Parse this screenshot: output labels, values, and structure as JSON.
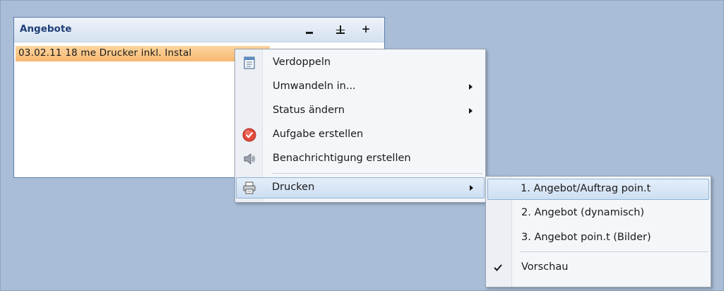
{
  "panel": {
    "title": "Angebote",
    "buttons": {
      "minimize": "minimize",
      "pin": "pin",
      "add": "+"
    },
    "record": "03.02.11  18  me  Drucker inkl. Instal"
  },
  "context_menu": {
    "items": [
      {
        "label": "Verdoppeln",
        "icon": "duplicate-icon"
      },
      {
        "label": "Umwandeln in...",
        "submenu": true
      },
      {
        "label": "Status ändern",
        "submenu": true
      },
      {
        "label": "Aufgabe erstellen",
        "icon": "task-check-icon"
      },
      {
        "label": "Benachrichtigung erstellen",
        "icon": "speaker-icon"
      },
      {
        "label": "Drucken",
        "icon": "printer-icon",
        "submenu": true,
        "highlighted": true
      }
    ]
  },
  "print_submenu": {
    "items": [
      {
        "label": "1. Angebot/Auftrag poin.t",
        "highlighted": true
      },
      {
        "label": "2. Angebot (dynamisch)"
      },
      {
        "label": "3. Angebot poin.t (Bilder)"
      },
      {
        "label": "Vorschau",
        "checked": true
      }
    ]
  },
  "colors": {
    "background": "#a9bdd7",
    "panel_title": "#1f3e78",
    "selection": "#f7b871",
    "menu_highlight": "#cddff2"
  }
}
